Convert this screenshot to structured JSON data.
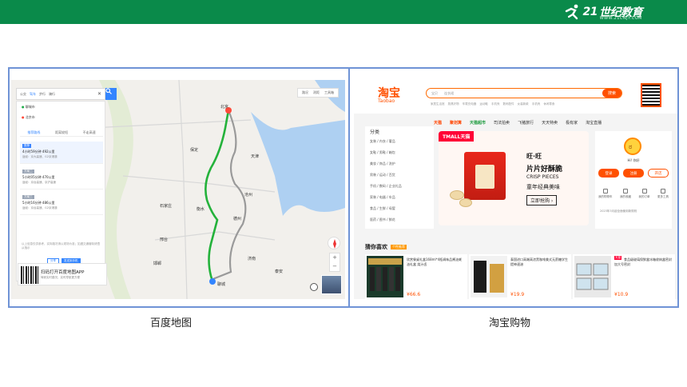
{
  "header": {
    "logo_mark": "21",
    "logo_text": "世纪教育",
    "logo_sub": "WWW.21CNJY.COM",
    "bar_color": "#0a8a4a"
  },
  "map": {
    "search_modes": [
      "公交",
      "驾车",
      "步行",
      "骑行"
    ],
    "from": "聊城市",
    "to": "北京市",
    "tabs": [
      "推荐路线",
      "距离较短",
      "不走高速"
    ],
    "routes": [
      {
        "tag": "推荐",
        "summary": "4小时59分钟  492公里",
        "detail": "途经：京大高速、G2京港澳"
      },
      {
        "tag": "方案二",
        "summary": "5小时05分钟  470公里",
        "detail": "途经：京台高速、京沪高速"
      },
      {
        "tag": "方案三",
        "summary": "5小时16分钟  486公里",
        "detail": "途经：京台高速、G2京港澳"
      }
    ],
    "note": "以上信息仅供参考，实际路况请以现场为准；如遇交通管制请遵从指示",
    "btn_share": "分享",
    "btn_send": "发送到手机",
    "qr_title": "扫码打开百度地图APP",
    "qr_sub": "驾驶实时路况，实时导航更方便",
    "tools": [
      "路况",
      "测距",
      "工具箱"
    ],
    "cities": [
      "北京",
      "天津",
      "石家庄",
      "衡水",
      "济南",
      "聊城",
      "保定",
      "德州",
      "沧州",
      "邢台",
      "邯郸",
      "泰安"
    ],
    "caption": "百度地图"
  },
  "taobao": {
    "logo": "淘宝",
    "logo_en": "Taobao",
    "search_scope": "宝贝",
    "search_placeholder": "连衣裙",
    "search_btn": "搜索",
    "hot_words": "家居生活馆 厨具好物 车载充电器 运动鞋 手机壳 数码配件 女装新款 手机壳 休闲零食",
    "nav": [
      "天猫",
      "聚划算",
      "天猫超市",
      "司法拍卖",
      "飞猪旅行",
      "天天特卖",
      "极有家",
      "淘宝直播"
    ],
    "categories_title": "分类",
    "categories": [
      "女装 / 内衣 / 奢品",
      "女鞋 / 男鞋 / 箱包",
      "美妆 / 饰品 / 洗护",
      "男装 / 运动 / 百货",
      "手机 / 数码 / 企业礼品",
      "家装 / 电器 / 车品",
      "食品 / 生鲜 / 母婴",
      "医药 / 图书 / 鲜花"
    ],
    "banner": {
      "badge": "TMALL天猫",
      "brand": "旺·旺",
      "title": "片片好酥脆",
      "en": "CRISP PIECES",
      "sub": "童年经典美味",
      "cta": "立即抢购 ›"
    },
    "user": {
      "greeting": "Hi! 你好",
      "login": "登录",
      "register": "注册",
      "open_shop": "开店",
      "links": [
        "我的购物车",
        "我的收藏",
        "我的订单",
        "更多工具"
      ],
      "notice": "2023年3月起全面使用新规则"
    },
    "guess_title": "猜你喜欢",
    "guess_tag": "个性推荐",
    "products": [
      {
        "title": "欣赏餐桌礼盒168ml*4瓶调味品酱油蚝油礼盒 烧汁卤",
        "price": "¥66.6"
      },
      {
        "title": "泰国进口高端高浓黑咖啡美式无蔗糖学生提神速溶",
        "price": "¥19.9"
      },
      {
        "tag": "天猫",
        "title": "食品级玻璃保鲜盒冰箱收纳盒密封加大号密封",
        "price": "¥10.9"
      }
    ],
    "caption": "淘宝购物",
    "brand_color": "#ff5000"
  }
}
